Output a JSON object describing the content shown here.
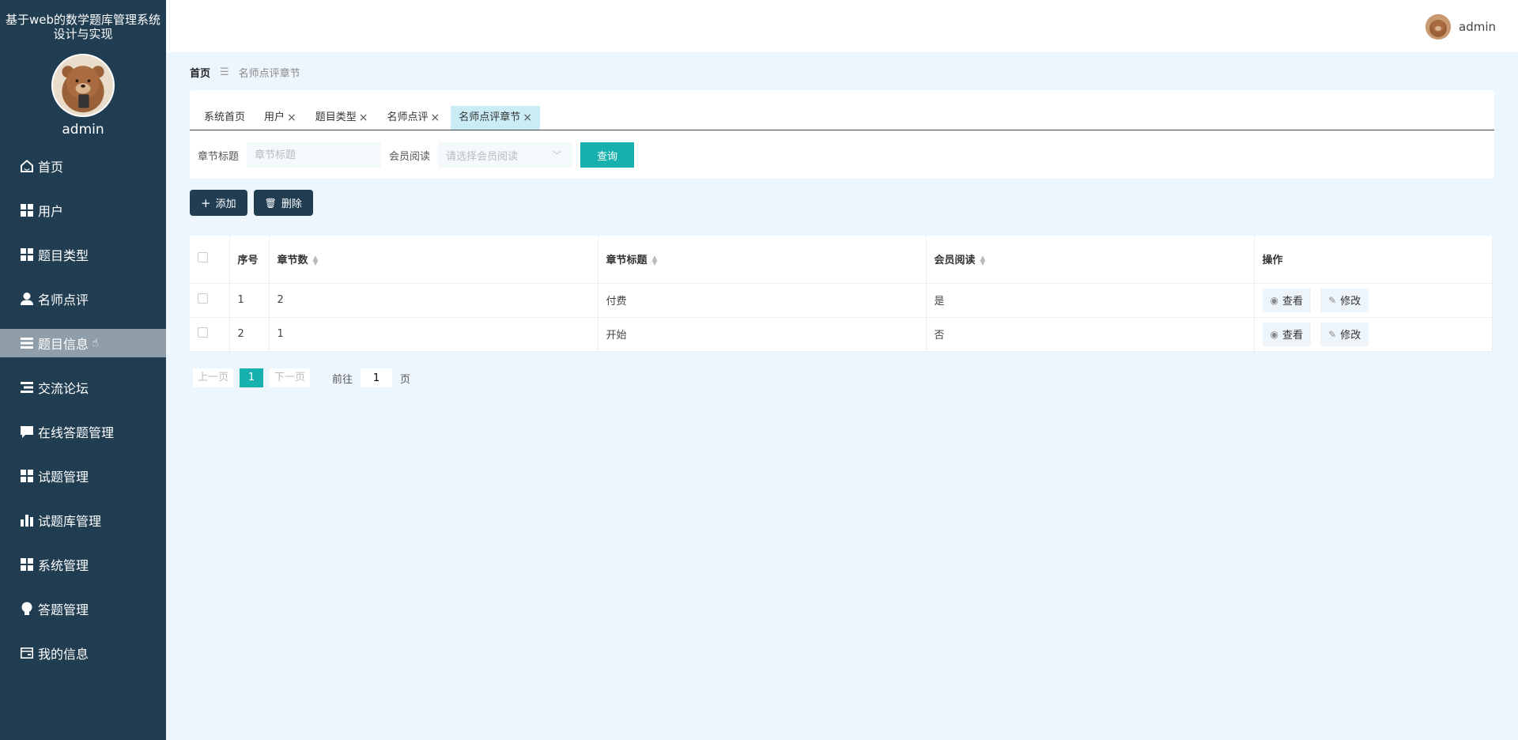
{
  "app": {
    "title": "基于web的数学题库管理系统设计与实现",
    "admin_name": "admin"
  },
  "sidebar": {
    "items": [
      {
        "label": "首页",
        "icon": "home-icon"
      },
      {
        "label": "用户",
        "icon": "grid-icon"
      },
      {
        "label": "题目类型",
        "icon": "grid-icon"
      },
      {
        "label": "名师点评",
        "icon": "person-icon"
      },
      {
        "label": "题目信息",
        "icon": "list-icon"
      },
      {
        "label": "交流论坛",
        "icon": "indent-list-icon"
      },
      {
        "label": "在线答题管理",
        "icon": "chat-icon"
      },
      {
        "label": "试题管理",
        "icon": "grid-icon"
      },
      {
        "label": "试题库管理",
        "icon": "bar-chart-icon"
      },
      {
        "label": "系统管理",
        "icon": "grid-icon"
      },
      {
        "label": "答题管理",
        "icon": "bulb-icon"
      },
      {
        "label": "我的信息",
        "icon": "wallet-icon"
      }
    ]
  },
  "header": {
    "user": "admin"
  },
  "breadcrumb": {
    "home": "首页",
    "separator": "☰",
    "current": "名师点评章节"
  },
  "tabs": [
    {
      "label": "系统首页",
      "closable": false
    },
    {
      "label": "用户",
      "closable": true
    },
    {
      "label": "题目类型",
      "closable": true
    },
    {
      "label": "名师点评",
      "closable": true
    },
    {
      "label": "名师点评章节",
      "closable": true,
      "active": true
    }
  ],
  "search": {
    "chapter_title_label": "章节标题",
    "chapter_title_placeholder": "章节标题",
    "member_read_label": "会员阅读",
    "member_read_placeholder": "请选择会员阅读",
    "query_button": "查询"
  },
  "actions": {
    "add": "添加",
    "delete": "删除"
  },
  "table": {
    "headers": {
      "index": "序号",
      "chapter_num": "章节数",
      "chapter_title": "章节标题",
      "member_read": "会员阅读",
      "operation": "操作"
    },
    "rows": [
      {
        "index": "1",
        "chapter_num": "2",
        "chapter_title": "付费",
        "member_read": "是"
      },
      {
        "index": "2",
        "chapter_num": "1",
        "chapter_title": "开始",
        "member_read": "否"
      }
    ],
    "view_label": "查看",
    "edit_label": "修改"
  },
  "pager": {
    "prev": "上一页",
    "current": "1",
    "next": "下一页",
    "goto_label": "前往",
    "goto_value": "1",
    "page_suffix": "页"
  },
  "colors": {
    "sidebar": "#213d52",
    "accent": "#16b1ae",
    "active_tab": "#c9ecf5"
  }
}
